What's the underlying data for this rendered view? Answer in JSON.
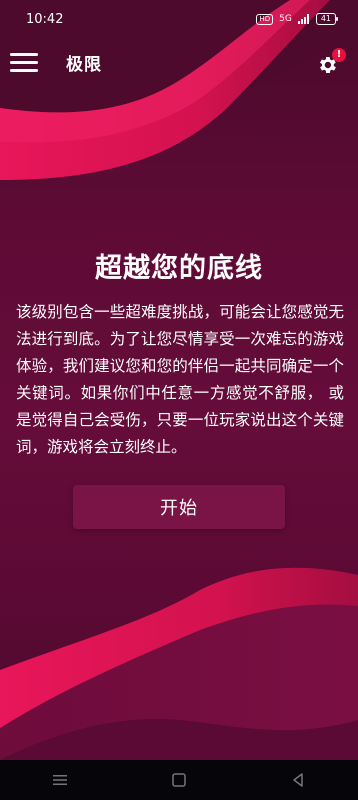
{
  "status_bar": {
    "time": "10:42",
    "hd_label": "HD",
    "network_label": "5G",
    "battery": "41"
  },
  "header": {
    "title": "极限",
    "notification_badge": "!"
  },
  "main": {
    "title": "超越您的底线",
    "description": "该级别包含一些超难度挑战，可能会让您感觉无法进行到底。为了让您尽情享受一次难忘的游戏体验，我们建议您和您的伴侣一起共同确定一个关键词。如果你们中任意一方感觉不舒服， 或是觉得自己会受伤，只要一位玩家说出这个关键词，游戏将会立刻终止。",
    "start_button": "开始"
  },
  "nav_bar": {
    "icons": [
      "menu-icon",
      "home-icon",
      "back-icon"
    ]
  },
  "colors": {
    "accent": "#e8165a",
    "background": "#5c0a34",
    "button": "#7a1446"
  }
}
